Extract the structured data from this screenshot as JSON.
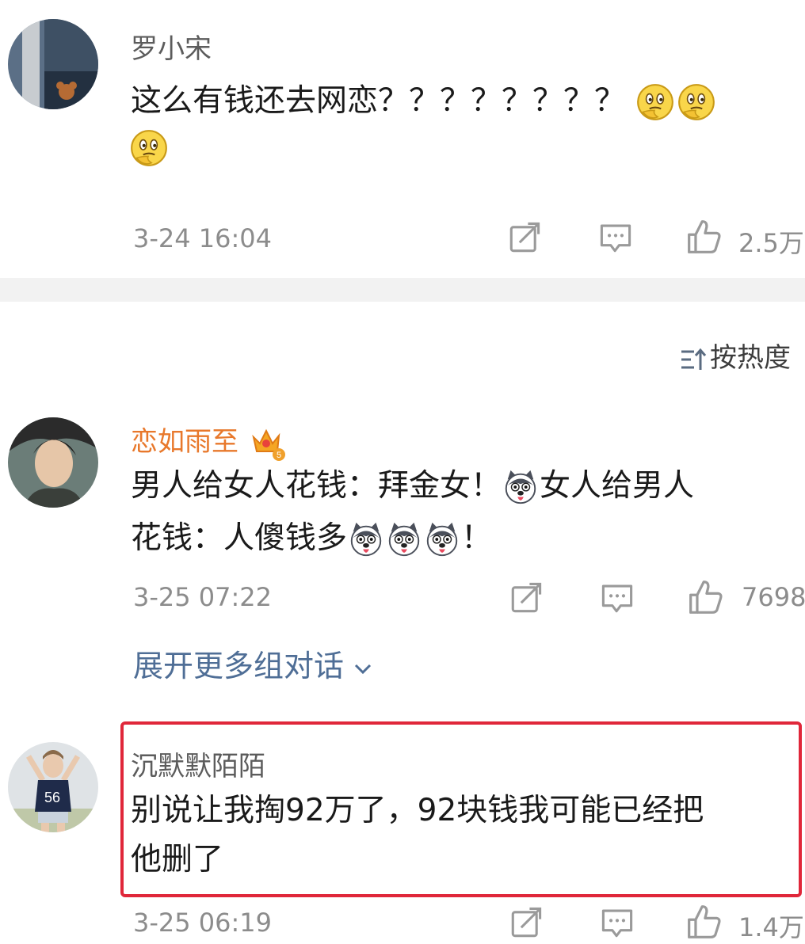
{
  "comments": [
    {
      "user": "罗小宋",
      "text_line1": "这么有钱还去网恋？？？？？？？？",
      "time": "3-24 16:04",
      "likes": "2.5万",
      "emoji": "thinking-face"
    },
    {
      "user": "恋如雨至",
      "text_line1_a": "男人给女人花钱：拜金女！",
      "text_line1_b": "女人给男人",
      "text_line2_a": "花钱：人傻钱多",
      "text_line2_b": "！",
      "time": "3-25 07:22",
      "likes": "7698",
      "emoji": "husky-dog-face",
      "badge": "vip-crown-badge"
    },
    {
      "user": "沉默默陌陌",
      "text_line1": "别说让我掏92万了，92块钱我可能已经把",
      "text_line2": "他删了",
      "time": "3-25 06:19",
      "likes": "1.4万",
      "highlight_color": "#e0273a"
    }
  ],
  "sort_label": "按热度",
  "expand_label": "展开更多组对话",
  "colors": {
    "vip_name": "#e8782b",
    "link": "#4f6e96",
    "meta": "#8c8c8c"
  }
}
